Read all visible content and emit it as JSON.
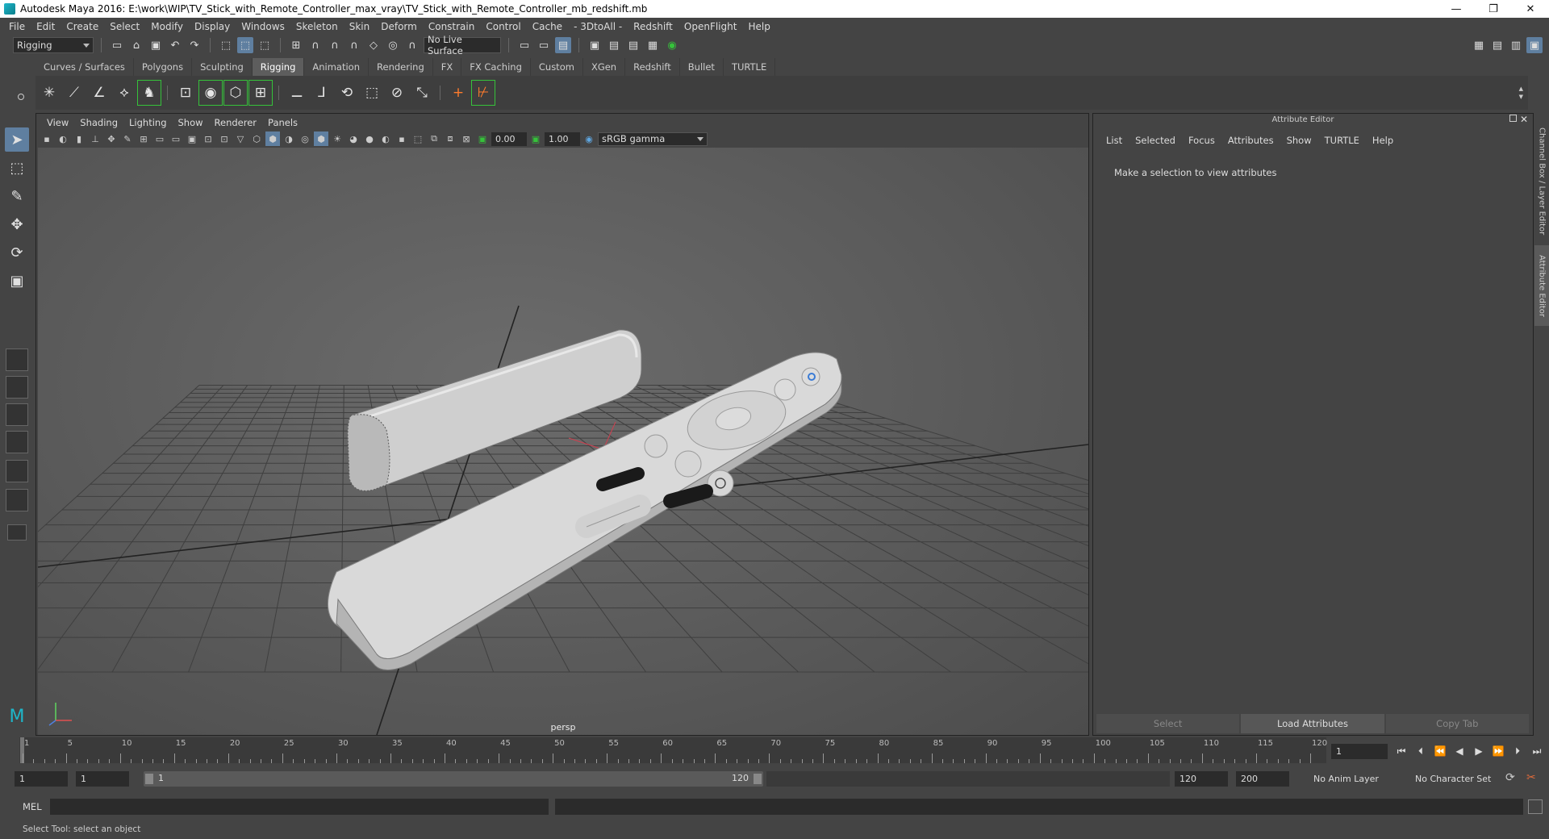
{
  "window": {
    "title": "Autodesk Maya 2016: E:\\work\\WIP\\TV_Stick_with_Remote_Controller_max_vray\\TV_Stick_with_Remote_Controller_mb_redshift.mb",
    "minimize": "—",
    "restore": "❐",
    "close": "✕"
  },
  "menubar": [
    "File",
    "Edit",
    "Create",
    "Select",
    "Modify",
    "Display",
    "Windows",
    "Skeleton",
    "Skin",
    "Deform",
    "Constrain",
    "Control",
    "Cache",
    "- 3DtoAll -",
    "Redshift",
    "OpenFlight",
    "Help"
  ],
  "statusline": {
    "menuset": "Rigging",
    "live_surface": "No Live Surface"
  },
  "shelf": {
    "tabs": [
      "Curves / Surfaces",
      "Polygons",
      "Sculpting",
      "Rigging",
      "Animation",
      "Rendering",
      "FX",
      "FX Caching",
      "Custom",
      "XGen",
      "Redshift",
      "Bullet",
      "TURTLE"
    ],
    "active_tab": "Rigging"
  },
  "viewport": {
    "menus": [
      "View",
      "Shading",
      "Lighting",
      "Show",
      "Renderer",
      "Panels"
    ],
    "exposure": "0.00",
    "gamma": "1.00",
    "color_space": "sRGB gamma",
    "camera_label": "persp"
  },
  "attribute_editor": {
    "title": "Attribute Editor",
    "menus": [
      "List",
      "Selected",
      "Focus",
      "Attributes",
      "Show",
      "TURTLE",
      "Help"
    ],
    "message": "Make a selection to view attributes",
    "buttons": {
      "select": "Select",
      "load": "Load Attributes",
      "copy": "Copy Tab"
    }
  },
  "side_tabs": {
    "channel_box": "Channel Box / Layer Editor",
    "attribute_editor": "Attribute Editor"
  },
  "timeslider": {
    "ticks": [
      "1",
      "5",
      "10",
      "15",
      "20",
      "25",
      "30",
      "35",
      "40",
      "45",
      "50",
      "55",
      "60",
      "65",
      "70",
      "75",
      "80",
      "85",
      "90",
      "95",
      "100",
      "105",
      "110",
      "115",
      "120"
    ],
    "current_frame": "1"
  },
  "range": {
    "start": "1",
    "playback_start": "1",
    "inner_start": "1",
    "inner_end": "120",
    "playback_end": "120",
    "end": "200",
    "anim_layer": "No Anim Layer",
    "character_set": "No Character Set"
  },
  "commandline": {
    "label": "MEL"
  },
  "helpline": "Select Tool: select an object",
  "colors": {
    "accent": "#5f7fa0",
    "shelf_highlight": "#35c23a",
    "viewport_bg": "#5e5e5e"
  }
}
